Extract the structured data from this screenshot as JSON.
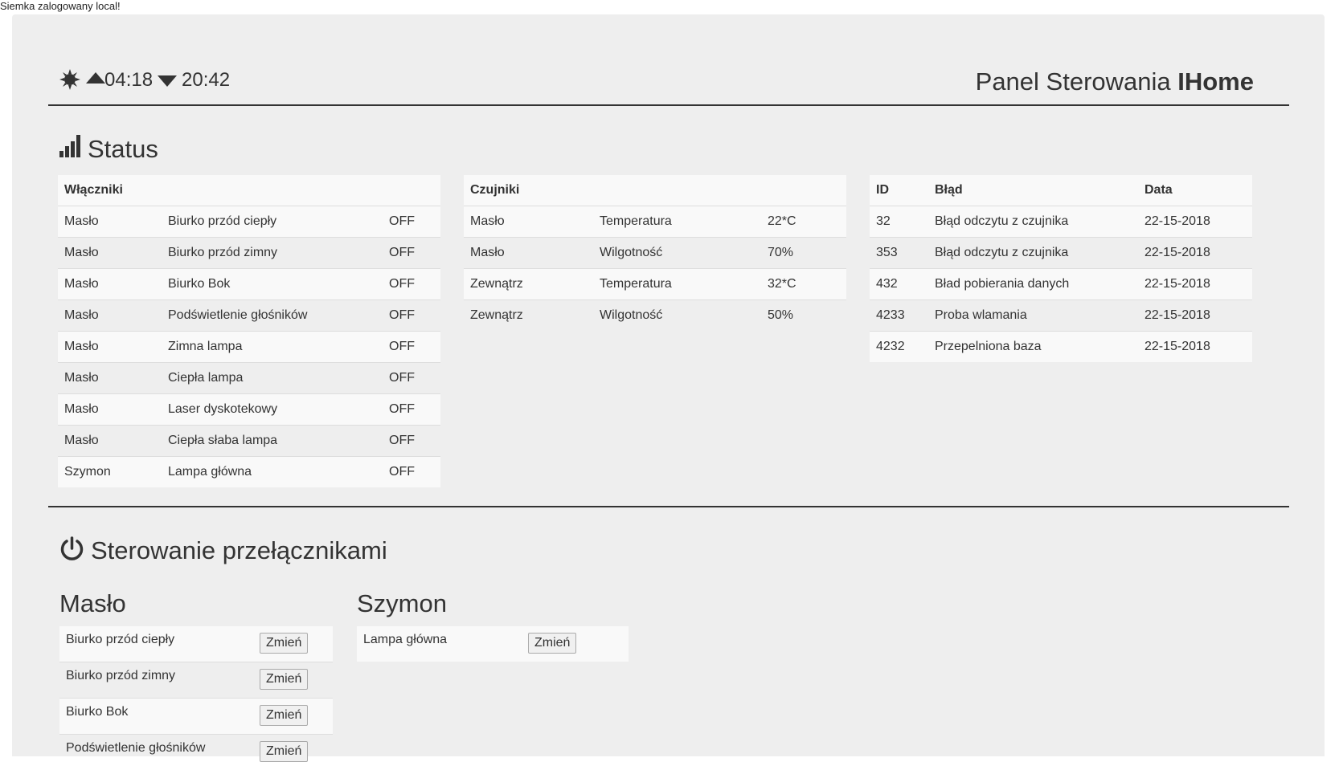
{
  "login_message": "Siemka zalogowany local!",
  "header": {
    "sunrise_time": "04:18",
    "sunset_time": "20:42",
    "title_prefix": "Panel Sterowania ",
    "title_brand": "IHome"
  },
  "status": {
    "title": "Status",
    "switches": {
      "header": "Włączniki",
      "rows": [
        {
          "owner": "Masło",
          "name": "Biurko przód ciepły",
          "state": "OFF"
        },
        {
          "owner": "Masło",
          "name": "Biurko przód zimny",
          "state": "OFF"
        },
        {
          "owner": "Masło",
          "name": "Biurko Bok",
          "state": "OFF"
        },
        {
          "owner": "Masło",
          "name": "Podświetlenie głośników",
          "state": "OFF"
        },
        {
          "owner": "Masło",
          "name": "Zimna lampa",
          "state": "OFF"
        },
        {
          "owner": "Masło",
          "name": "Ciepła lampa",
          "state": "OFF"
        },
        {
          "owner": "Masło",
          "name": "Laser dyskotekowy",
          "state": "OFF"
        },
        {
          "owner": "Masło",
          "name": "Ciepła słaba lampa",
          "state": "OFF"
        },
        {
          "owner": "Szymon",
          "name": "Lampa główna",
          "state": "OFF"
        }
      ]
    },
    "sensors": {
      "header": "Czujniki",
      "rows": [
        {
          "location": "Masło",
          "type": "Temperatura",
          "value": "22*C"
        },
        {
          "location": "Masło",
          "type": "Wilgotność",
          "value": "70%"
        },
        {
          "location": "Zewnątrz",
          "type": "Temperatura",
          "value": "32*C"
        },
        {
          "location": "Zewnątrz",
          "type": "Wilgotność",
          "value": "50%"
        }
      ]
    },
    "errors": {
      "col_id": "ID",
      "col_error": "Błąd",
      "col_date": "Data",
      "rows": [
        {
          "id": "32",
          "error": "Błąd odczytu z czujnika",
          "date": "22-15-2018"
        },
        {
          "id": "353",
          "error": "Błąd odczytu z czujnika",
          "date": "22-15-2018"
        },
        {
          "id": "432",
          "error": "Bład pobierania danych",
          "date": "22-15-2018"
        },
        {
          "id": "4233",
          "error": "Proba wlamania",
          "date": "22-15-2018"
        },
        {
          "id": "4232",
          "error": "Przepelniona baza",
          "date": "22-15-2018"
        }
      ]
    }
  },
  "control": {
    "title": "Sterowanie przełącznikami",
    "change_label": "Zmień",
    "groups": [
      {
        "name": "Masło",
        "items": [
          "Biurko przód ciepły",
          "Biurko przód zimny",
          "Biurko Bok",
          "Podświetlenie głośników"
        ]
      },
      {
        "name": "Szymon",
        "items": [
          "Lampa główna"
        ]
      }
    ]
  }
}
